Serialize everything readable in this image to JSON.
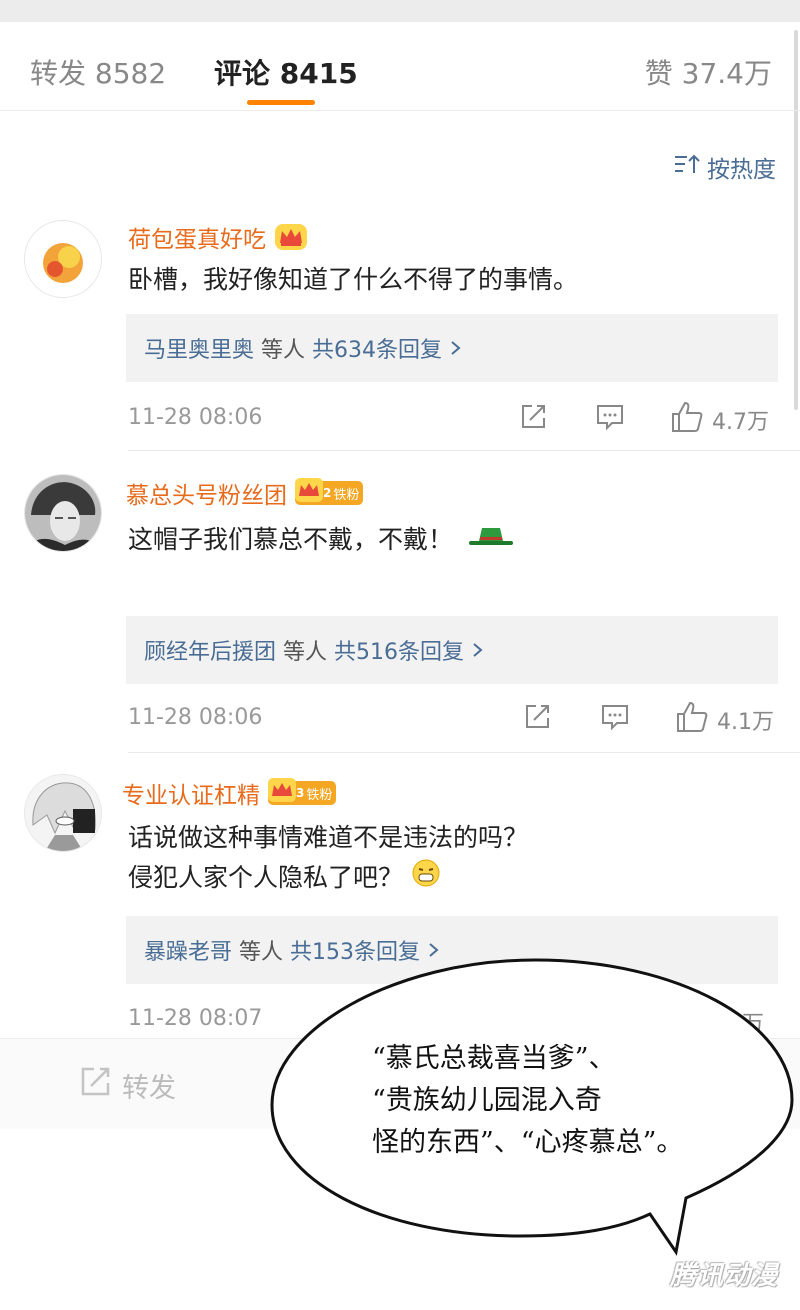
{
  "tabs": {
    "repost_label": "转发",
    "repost_count": "8582",
    "comment_label": "评论",
    "comment_count": "8415",
    "like_label": "赞",
    "like_count": "37.4万"
  },
  "sort": {
    "label": "按热度",
    "icon": "sort-icon"
  },
  "comments": [
    {
      "username": "荷包蛋真好吃",
      "text_lines": [
        "卧槽，我好像知道了什么不得了的事情。"
      ],
      "reply_user": "马里奥里奥",
      "reply_mid": "等人",
      "reply_count": "共634条回复",
      "time": "11-28 08:06",
      "likes": "4.7万"
    },
    {
      "username": "慕总头号粉丝团",
      "badge_level": "2",
      "badge_text": "铁粉",
      "text_lines": [
        "这帽子我们慕总不戴，不戴！"
      ],
      "reply_user": "顾经年后援团",
      "reply_mid": "等人",
      "reply_count": "共516条回复",
      "time": "11-28 08:06",
      "likes": "4.1万"
    },
    {
      "username": "专业认证杠精",
      "badge_level": "3",
      "badge_text": "铁粉",
      "text_lines": [
        "话说做这种事情难道不是违法的吗？",
        "侵犯人家个人隐私了吧？"
      ],
      "reply_user": "暴躁老哥",
      "reply_mid": "等人",
      "reply_count": "共153条回复",
      "time": "11-28 08:07",
      "likes": "3万"
    }
  ],
  "bottom_bar": {
    "repost_label": "转发"
  },
  "speech_bubble": {
    "lines": [
      "“慕氏总裁喜当爹”、",
      "“贵族幼儿园混入奇",
      "怪的东西”、“心疼慕总”。"
    ]
  },
  "watermark": "腾讯动漫",
  "colors": {
    "accent": "#ff8200",
    "username": "#e86b1c",
    "link": "#4a6d95"
  }
}
